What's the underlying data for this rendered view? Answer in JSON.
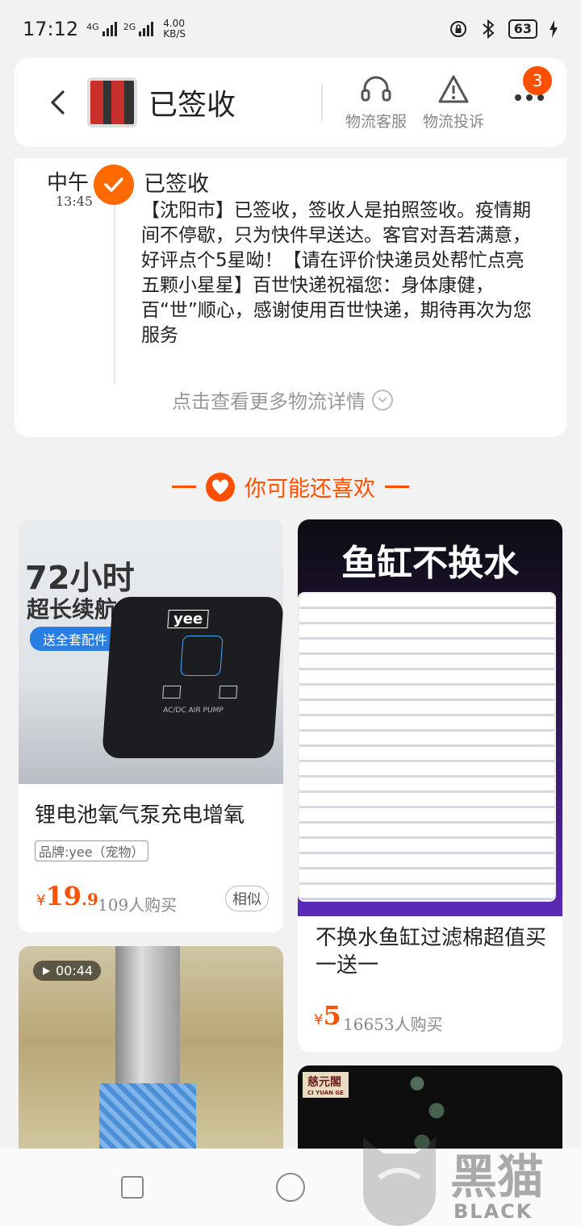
{
  "status": {
    "time": "17:12",
    "sig1": "4G",
    "sig2": "2G",
    "speed_value": "4.00",
    "speed_unit": "KB/S",
    "battery": "63"
  },
  "header": {
    "title": "已签收",
    "cs_label": "物流客服",
    "complaint_label": "物流投诉",
    "badge": "3"
  },
  "track": {
    "period": "中午",
    "time": "13:45",
    "status": "已签收",
    "desc": "【沈阳市】已签收，签收人是拍照签收。疫情期间不停歇，只为快件早送达。客官对吾若满意，好评点个5星呦！【请在评价快递员处帮忙点亮五颗小星星】百世快递祝福您：身体康健，百“世”顺心，感谢使用百世快递，期待再次为您服务",
    "more": "点击查看更多物流详情"
  },
  "recommend": {
    "title": "你可能还喜欢"
  },
  "products": [
    {
      "name": "锂电池氧气泵充电增氧",
      "brand": "品牌:yee（宠物）",
      "yen": "¥",
      "price_int": "19",
      "price_dec": ".9",
      "sold": "109人购买",
      "similar": "相似",
      "img_line1": "72小时",
      "img_line2": "超长续航",
      "img_tag": "送全套配件",
      "img_brand": "yee",
      "img_device": "AC/DC AIR PUMP"
    },
    {
      "name": "不换水鱼缸过滤棉超值买一送一",
      "yen": "¥",
      "price_int": "5",
      "sold": "16653人购买",
      "img_title": "鱼缸不换水"
    },
    {
      "video_time": "00:44"
    },
    {
      "img_brand": "慈元閣",
      "img_sub": "CI YUAN GE"
    }
  ],
  "watermark": {
    "cn": "黑猫",
    "en": "BLACK CAT"
  },
  "colors": {
    "accent": "#ff5000",
    "check": "#ff6a00",
    "bg": "#f2f2f2"
  }
}
